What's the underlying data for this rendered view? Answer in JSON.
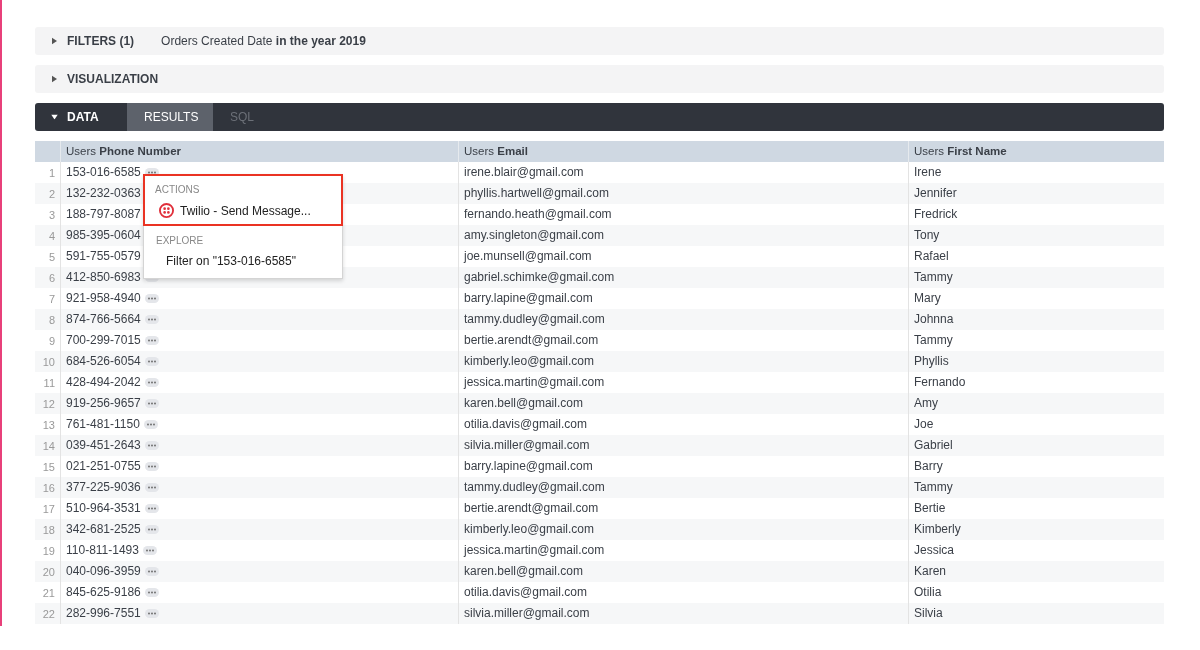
{
  "filters": {
    "label": "FILTERS (1)",
    "expanded": false,
    "summary": "Orders Created Date **in the year 2019**"
  },
  "visualization": {
    "label": "VISUALIZATION",
    "expanded": false
  },
  "data_bar": {
    "label": "DATA",
    "expanded": true,
    "tabs": [
      {
        "label": "RESULTS",
        "selected": true
      },
      {
        "label": "SQL",
        "selected": false
      }
    ]
  },
  "table": {
    "columns": [
      "Users **Phone Number**",
      "Users **Email**",
      "Users **First Name**"
    ],
    "rows": [
      {
        "n": "1",
        "cells": [
          "153-016-6585",
          "irene.blair@gmail.com",
          "Irene"
        ]
      },
      {
        "n": "2",
        "more": false,
        "cells": [
          "132-232-0363",
          "phyllis.hartwell@gmail.com",
          "Jennifer"
        ]
      },
      {
        "n": "3",
        "more": false,
        "cells": [
          "188-797-8087",
          "fernando.heath@gmail.com",
          "Fredrick"
        ]
      },
      {
        "n": "4",
        "more": false,
        "cells": [
          "985-395-0604",
          "amy.singleton@gmail.com",
          "Tony"
        ]
      },
      {
        "n": "5",
        "more": false,
        "cells": [
          "591-755-0579",
          "joe.munsell@gmail.com",
          "Rafael"
        ]
      },
      {
        "n": "6",
        "cells": [
          "412-850-6983",
          "gabriel.schimke@gmail.com",
          "Tammy"
        ]
      },
      {
        "n": "7",
        "cells": [
          "921-958-4940",
          "barry.lapine@gmail.com",
          "Mary"
        ]
      },
      {
        "n": "8",
        "cells": [
          "874-766-5664",
          "tammy.dudley@gmail.com",
          "Johnna"
        ]
      },
      {
        "n": "9",
        "cells": [
          "700-299-7015",
          "bertie.arendt@gmail.com",
          "Tammy"
        ]
      },
      {
        "n": "10",
        "cells": [
          "684-526-6054",
          "kimberly.leo@gmail.com",
          "Phyllis"
        ]
      },
      {
        "n": "11",
        "cells": [
          "428-494-2042",
          "jessica.martin@gmail.com",
          "Fernando"
        ]
      },
      {
        "n": "12",
        "cells": [
          "919-256-9657",
          "karen.bell@gmail.com",
          "Amy"
        ]
      },
      {
        "n": "13",
        "cells": [
          "761-481-1150",
          "otilia.davis@gmail.com",
          "Joe"
        ]
      },
      {
        "n": "14",
        "cells": [
          "039-451-2643",
          "silvia.miller@gmail.com",
          "Gabriel"
        ]
      },
      {
        "n": "15",
        "cells": [
          "021-251-0755",
          "barry.lapine@gmail.com",
          "Barry"
        ]
      },
      {
        "n": "16",
        "cells": [
          "377-225-9036",
          "tammy.dudley@gmail.com",
          "Tammy"
        ]
      },
      {
        "n": "17",
        "cells": [
          "510-964-3531",
          "bertie.arendt@gmail.com",
          "Bertie"
        ]
      },
      {
        "n": "18",
        "cells": [
          "342-681-2525",
          "kimberly.leo@gmail.com",
          "Kimberly"
        ]
      },
      {
        "n": "19",
        "cells": [
          "110-811-1493",
          "jessica.martin@gmail.com",
          "Jessica"
        ]
      },
      {
        "n": "20",
        "cells": [
          "040-096-3959",
          "karen.bell@gmail.com",
          "Karen"
        ]
      },
      {
        "n": "21",
        "cells": [
          "845-625-9186",
          "otilia.davis@gmail.com",
          "Otilia"
        ]
      },
      {
        "n": "22",
        "cells": [
          "282-996-7551",
          "silvia.miller@gmail.com",
          "Silvia"
        ]
      }
    ]
  },
  "popup": {
    "sections": [
      {
        "heading": "ACTIONS",
        "highlighted": true,
        "items": [
          {
            "label": "Twilio - Send Message...",
            "kind": "action"
          }
        ]
      },
      {
        "heading": "EXPLORE",
        "highlighted": false,
        "items": [
          {
            "label": "Filter on \"153-016-6585\"",
            "kind": "filter"
          }
        ]
      }
    ]
  }
}
